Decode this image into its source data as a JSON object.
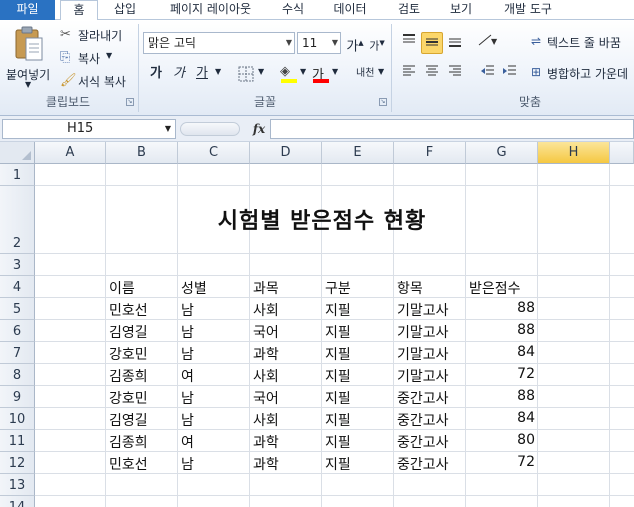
{
  "tabs": [
    "파일",
    "홈",
    "삽입",
    "페이지 레이아웃",
    "수식",
    "데이터",
    "검토",
    "보기",
    "개발 도구"
  ],
  "ribbon": {
    "clipboard": {
      "paste_label": "붙여넣기",
      "cut_label": "잘라내기",
      "copy_label": "복사",
      "format_painter_label": "서식 복사",
      "group_label": "클립보드"
    },
    "font": {
      "font_name": "맑은 고딕",
      "font_size": "11",
      "grow_label": "가",
      "shrink_label": "가",
      "bold_label": "가",
      "italic_label": "가",
      "underline_label": "가",
      "font_color_label": "가",
      "phonetic_label": "내천",
      "group_label": "글꼴"
    },
    "alignment": {
      "wrap_text_label": "텍스트 줄 바꿈",
      "merge_center_label": "병합하고 가운데",
      "group_label": "맞춤"
    }
  },
  "formula_bar": {
    "name_box": "H15",
    "fx_label": "fx",
    "formula": ""
  },
  "grid": {
    "columns": [
      "A",
      "B",
      "C",
      "D",
      "E",
      "F",
      "G",
      "H"
    ],
    "selected_column": "H",
    "rows": [
      "1",
      "2",
      "3",
      "4",
      "5",
      "6",
      "7",
      "8",
      "9",
      "10",
      "11",
      "12",
      "13",
      "14"
    ],
    "title": "시험별 받은점수 현황",
    "headers": [
      "이름",
      "성별",
      "과목",
      "구분",
      "항목",
      "받은점수"
    ],
    "records": [
      [
        "민호선",
        "남",
        "사회",
        "지필",
        "기말고사",
        "88"
      ],
      [
        "김영길",
        "남",
        "국어",
        "지필",
        "기말고사",
        "88"
      ],
      [
        "강호민",
        "남",
        "과학",
        "지필",
        "기말고사",
        "84"
      ],
      [
        "김종희",
        "여",
        "사회",
        "지필",
        "기말고사",
        "72"
      ],
      [
        "강호민",
        "남",
        "국어",
        "지필",
        "중간고사",
        "88"
      ],
      [
        "김영길",
        "남",
        "사회",
        "지필",
        "중간고사",
        "84"
      ],
      [
        "김종희",
        "여",
        "과학",
        "지필",
        "중간고사",
        "80"
      ],
      [
        "민호선",
        "남",
        "과학",
        "지필",
        "중간고사",
        "72"
      ]
    ]
  },
  "colors": {
    "file_tab": "#2a72c2",
    "selected_header": "#f5c842",
    "highlight_fill": "#ffff00",
    "font_color": "#ff0000"
  }
}
